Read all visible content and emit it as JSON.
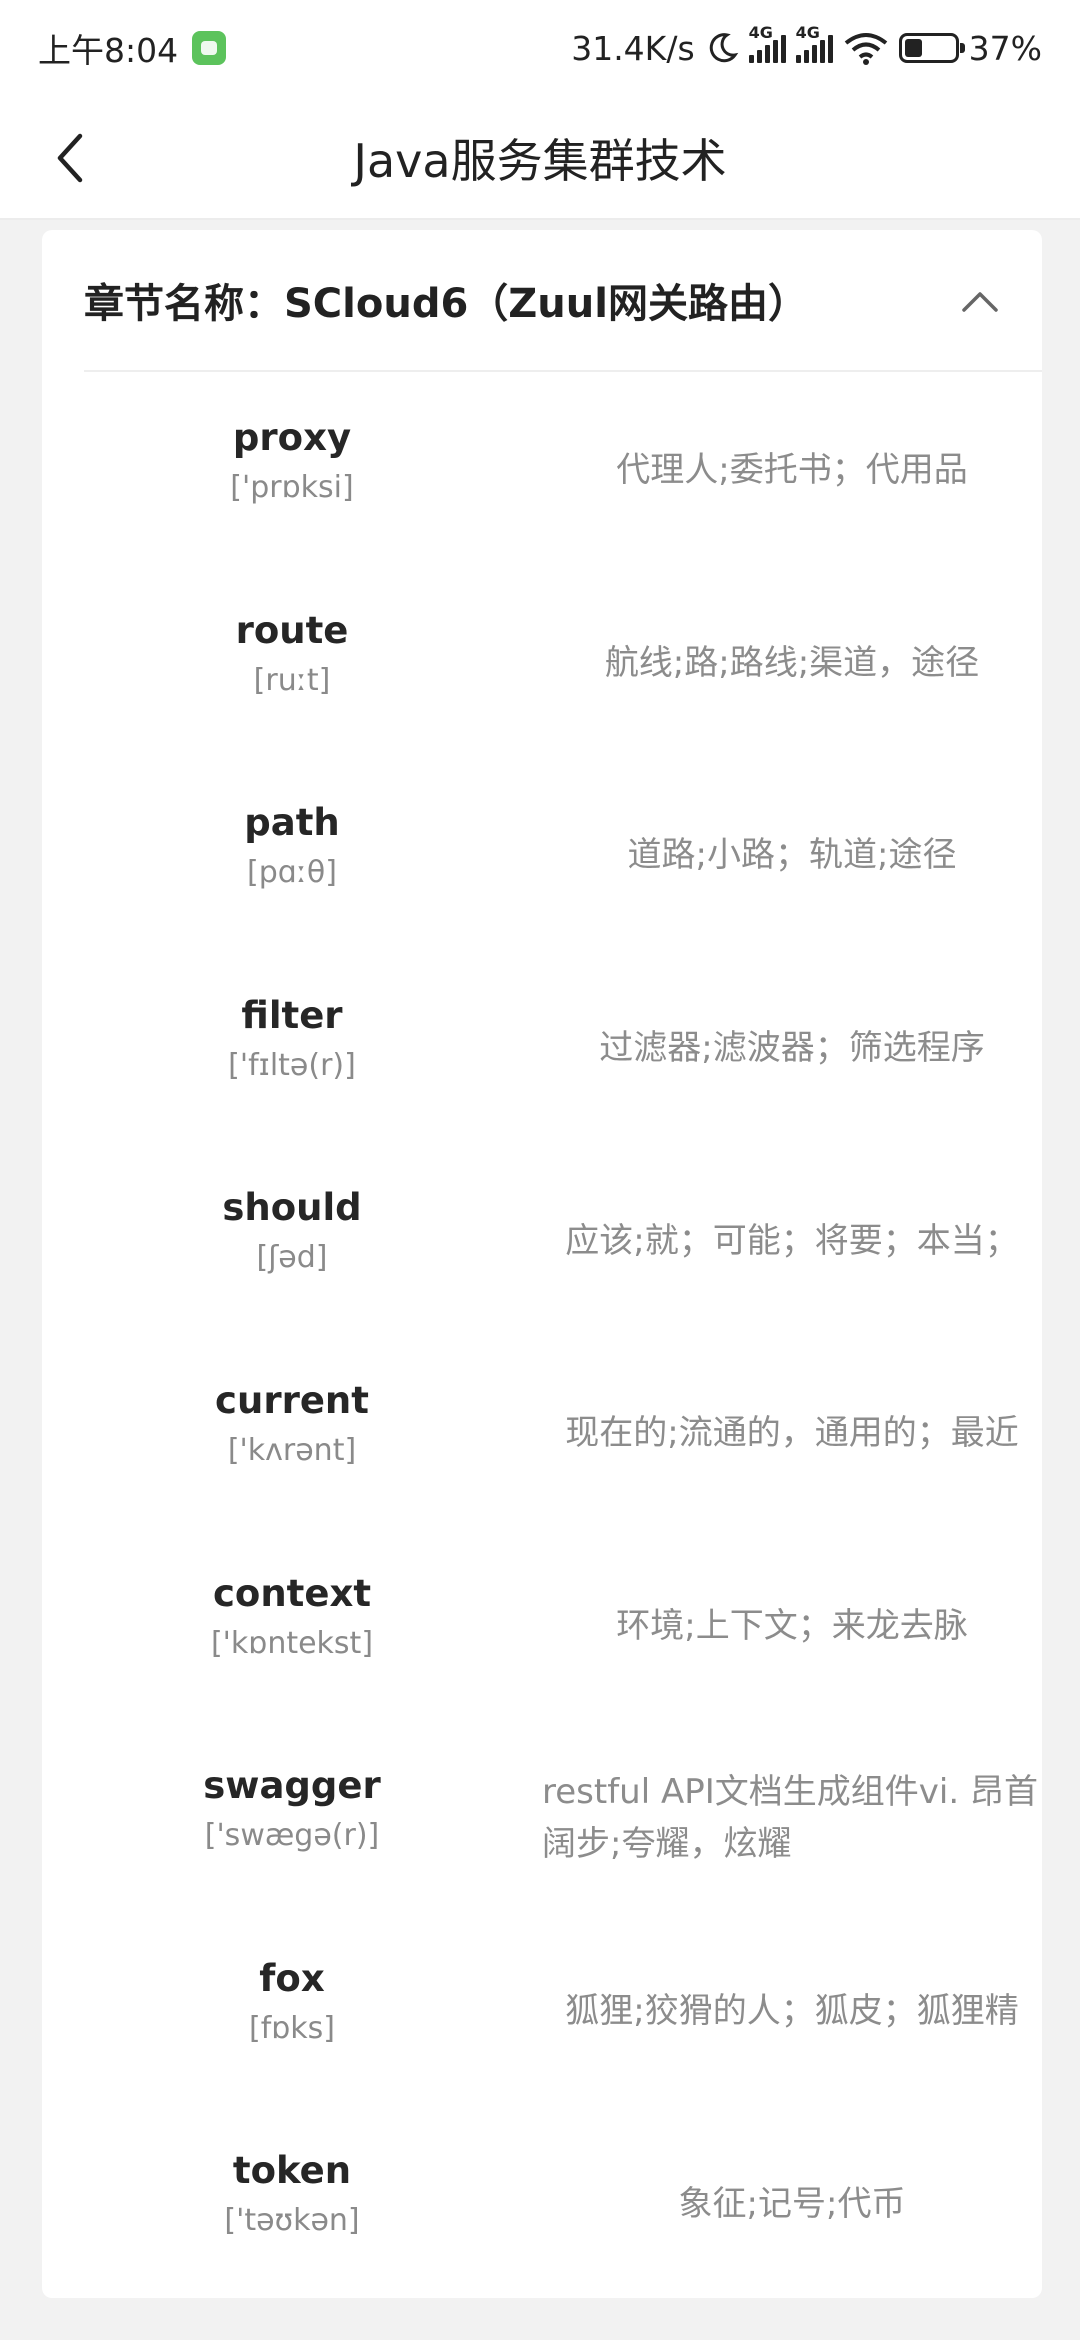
{
  "status": {
    "time": "上午8:04",
    "speed": "31.4K/s",
    "net1": "4G",
    "net2": "4G",
    "battery": "37%"
  },
  "header": {
    "title": "Java服务集群技术"
  },
  "chapter": {
    "title": "章节名称：SCloud6（Zuul网关路由）"
  },
  "words": [
    {
      "word": "proxy",
      "phonetic": "['prɒksi]",
      "meaning": "代理人;委托书；代用品"
    },
    {
      "word": "route",
      "phonetic": "[ruːt]",
      "meaning": "航线;路;路线;渠道，途径"
    },
    {
      "word": "path",
      "phonetic": "[pɑːθ]",
      "meaning": "道路;小路；轨道;途径"
    },
    {
      "word": "filter",
      "phonetic": "['fɪltə(r)]",
      "meaning": "过滤器;滤波器；筛选程序"
    },
    {
      "word": "should",
      "phonetic": "[ʃəd]",
      "meaning": "应该;就；可能；将要；本当；"
    },
    {
      "word": "current",
      "phonetic": "['kʌrənt]",
      "meaning": "现在的;流通的，通用的；最近"
    },
    {
      "word": "context",
      "phonetic": "['kɒntekst]",
      "meaning": "环境;上下文；来龙去脉"
    },
    {
      "word": "swagger",
      "phonetic": "['swægə(r)]",
      "meaning": "restful API文档生成组件vi. 昂首阔步;夸耀，炫耀"
    },
    {
      "word": "fox",
      "phonetic": "[fɒks]",
      "meaning": "狐狸;狡猾的人；狐皮；狐狸精"
    },
    {
      "word": "token",
      "phonetic": "['təʊkən]",
      "meaning": "象征;记号;代币"
    }
  ]
}
